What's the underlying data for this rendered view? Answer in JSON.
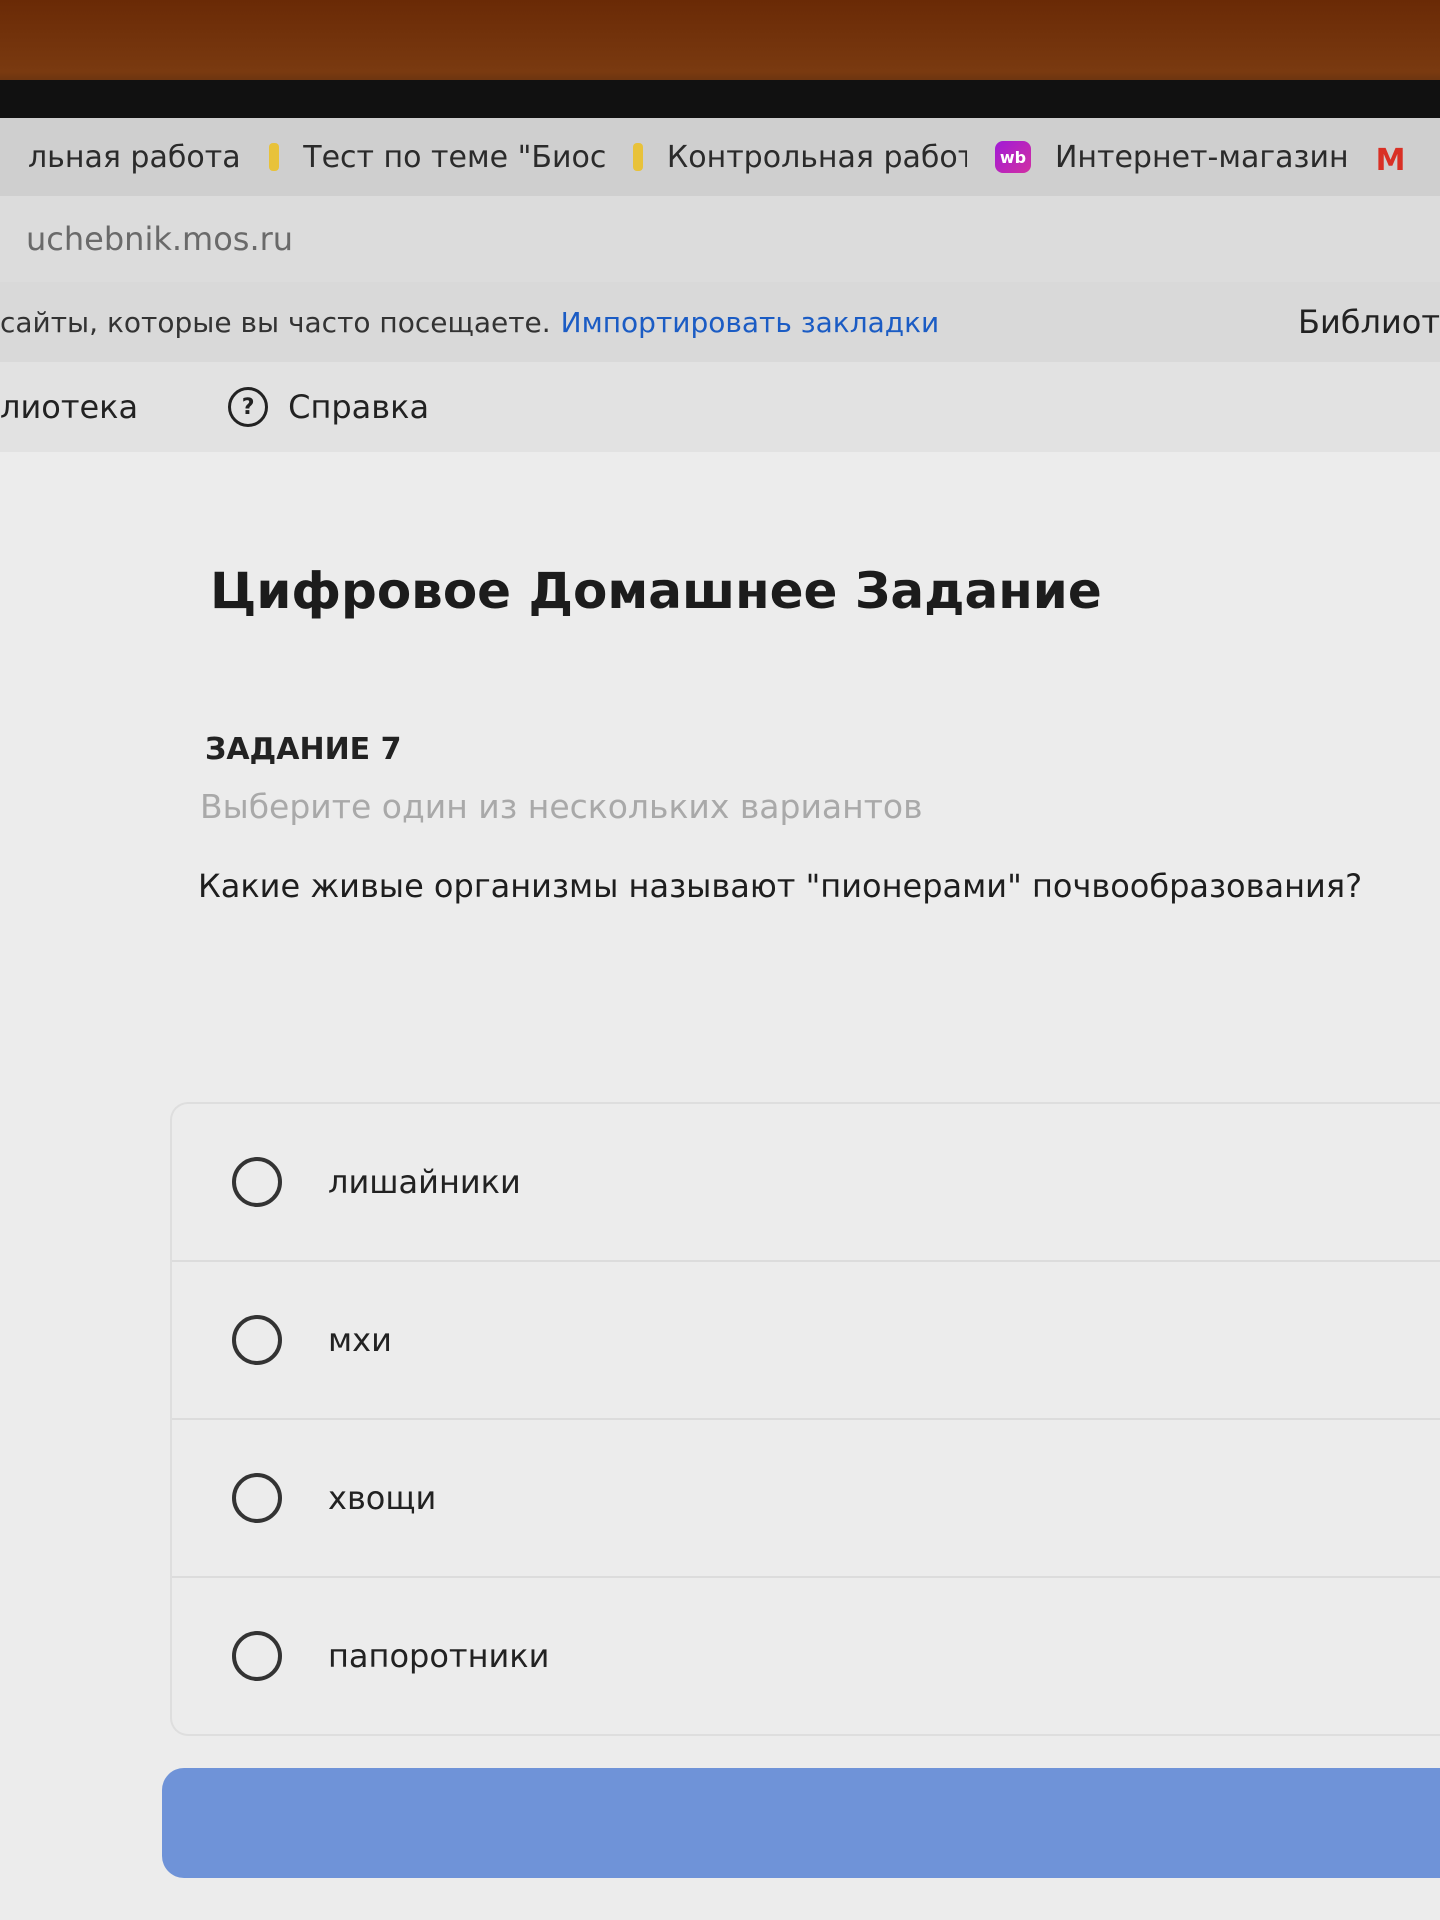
{
  "browser": {
    "tabs": [
      {
        "label": "льная работа",
        "favicon": "none"
      },
      {
        "label": "Тест по теме \"Биосф",
        "favicon": "yellow-doc-icon"
      },
      {
        "label": "Контрольная работа",
        "favicon": "yellow-doc-icon"
      },
      {
        "label": "Интернет-магазин V",
        "favicon": "wb-icon"
      },
      {
        "label": "M",
        "favicon": "gmail-icon"
      }
    ],
    "wb_badge": "wb",
    "url": "uchebnik.mos.ru",
    "bookmarks_hint": "сайты, которые вы часто посещаете.",
    "import_bookmarks": "Импортировать закладки",
    "bookmarks_right": "Библиот"
  },
  "site_nav": {
    "library": "лиотека",
    "help_icon": "?",
    "help": "Справка"
  },
  "page": {
    "title": "Цифровое Домашнее Задание",
    "task_number": "ЗАДАНИЕ 7",
    "instruction": "Выберите один из нескольких вариантов",
    "question": "Какие живые организмы называют \"пионерами\" почвообразования?",
    "options": [
      {
        "label": "лишайники",
        "selected": false
      },
      {
        "label": "мхи",
        "selected": false
      },
      {
        "label": "хвощи",
        "selected": false
      },
      {
        "label": "папоротники",
        "selected": false
      }
    ],
    "submit_color": "#6f93d8"
  }
}
